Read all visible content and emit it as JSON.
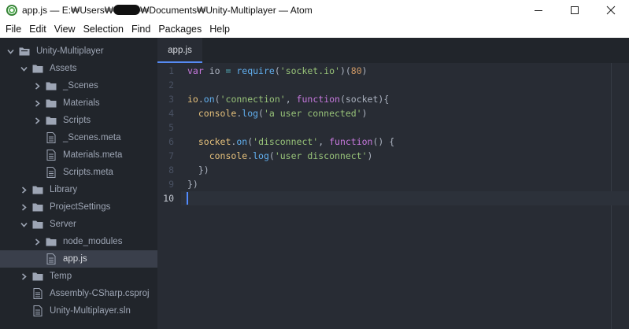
{
  "window": {
    "title_prefix": "app.js — E:₩Users₩",
    "title_suffix": "₩Documents₩Unity-Multiplayer — Atom"
  },
  "menu": [
    "File",
    "Edit",
    "View",
    "Selection",
    "Find",
    "Packages",
    "Help"
  ],
  "tree": {
    "items": [
      {
        "label": "Unity-Multiplayer",
        "type": "project",
        "expanded": true
      },
      {
        "label": "Assets",
        "type": "folder",
        "expanded": true
      },
      {
        "label": "_Scenes",
        "type": "folder",
        "expanded": false
      },
      {
        "label": "Materials",
        "type": "folder",
        "expanded": false
      },
      {
        "label": "Scripts",
        "type": "folder",
        "expanded": false
      },
      {
        "label": "_Scenes.meta",
        "type": "file"
      },
      {
        "label": "Materials.meta",
        "type": "file"
      },
      {
        "label": "Scripts.meta",
        "type": "file"
      },
      {
        "label": "Library",
        "type": "folder",
        "expanded": false
      },
      {
        "label": "ProjectSettings",
        "type": "folder",
        "expanded": false
      },
      {
        "label": "Server",
        "type": "folder",
        "expanded": true
      },
      {
        "label": "node_modules",
        "type": "folder",
        "expanded": false
      },
      {
        "label": "app.js",
        "type": "file",
        "selected": true
      },
      {
        "label": "Temp",
        "type": "folder",
        "expanded": false
      },
      {
        "label": "Assembly-CSharp.csproj",
        "type": "file"
      },
      {
        "label": "Unity-Multiplayer.sln",
        "type": "file"
      }
    ]
  },
  "tabs": [
    {
      "label": "app.js",
      "active": true
    }
  ],
  "editor": {
    "line_numbers": [
      "1",
      "2",
      "3",
      "4",
      "5",
      "6",
      "7",
      "8",
      "9",
      "10"
    ],
    "current_line": 10,
    "lines": [
      [
        {
          "t": "var",
          "c": "kw"
        },
        {
          "t": " io ",
          "c": "pl"
        },
        {
          "t": "=",
          "c": "op"
        },
        {
          "t": " ",
          "c": "pl"
        },
        {
          "t": "require",
          "c": "fn"
        },
        {
          "t": "(",
          "c": "pl"
        },
        {
          "t": "'socket.io'",
          "c": "str"
        },
        {
          "t": ")(",
          "c": "pl"
        },
        {
          "t": "80",
          "c": "num"
        },
        {
          "t": ")",
          "c": "pl"
        }
      ],
      [],
      [
        {
          "t": "io",
          "c": "ob"
        },
        {
          "t": ".",
          "c": "pl"
        },
        {
          "t": "on",
          "c": "fn"
        },
        {
          "t": "(",
          "c": "pl"
        },
        {
          "t": "'connection'",
          "c": "str"
        },
        {
          "t": ", ",
          "c": "pl"
        },
        {
          "t": "function",
          "c": "kw"
        },
        {
          "t": "(socket){",
          "c": "pl"
        }
      ],
      [
        {
          "t": "  ",
          "c": "pl"
        },
        {
          "t": "console",
          "c": "ob"
        },
        {
          "t": ".",
          "c": "pl"
        },
        {
          "t": "log",
          "c": "fn"
        },
        {
          "t": "(",
          "c": "pl"
        },
        {
          "t": "'a user connected'",
          "c": "str"
        },
        {
          "t": ")",
          "c": "pl"
        }
      ],
      [],
      [
        {
          "t": "  ",
          "c": "pl"
        },
        {
          "t": "socket",
          "c": "ob"
        },
        {
          "t": ".",
          "c": "pl"
        },
        {
          "t": "on",
          "c": "fn"
        },
        {
          "t": "(",
          "c": "pl"
        },
        {
          "t": "'disconnect'",
          "c": "str"
        },
        {
          "t": ", ",
          "c": "pl"
        },
        {
          "t": "function",
          "c": "kw"
        },
        {
          "t": "() {",
          "c": "pl"
        }
      ],
      [
        {
          "t": "    ",
          "c": "pl"
        },
        {
          "t": "console",
          "c": "ob"
        },
        {
          "t": ".",
          "c": "pl"
        },
        {
          "t": "log",
          "c": "fn"
        },
        {
          "t": "(",
          "c": "pl"
        },
        {
          "t": "'user disconnect'",
          "c": "str"
        },
        {
          "t": ")",
          "c": "pl"
        }
      ],
      [
        {
          "t": "  })",
          "c": "pl"
        }
      ],
      [
        {
          "t": "})",
          "c": "pl"
        }
      ],
      []
    ]
  },
  "colors": {
    "tree_bg": "#21252b",
    "editor_bg": "#282c34",
    "accent": "#568af2"
  }
}
